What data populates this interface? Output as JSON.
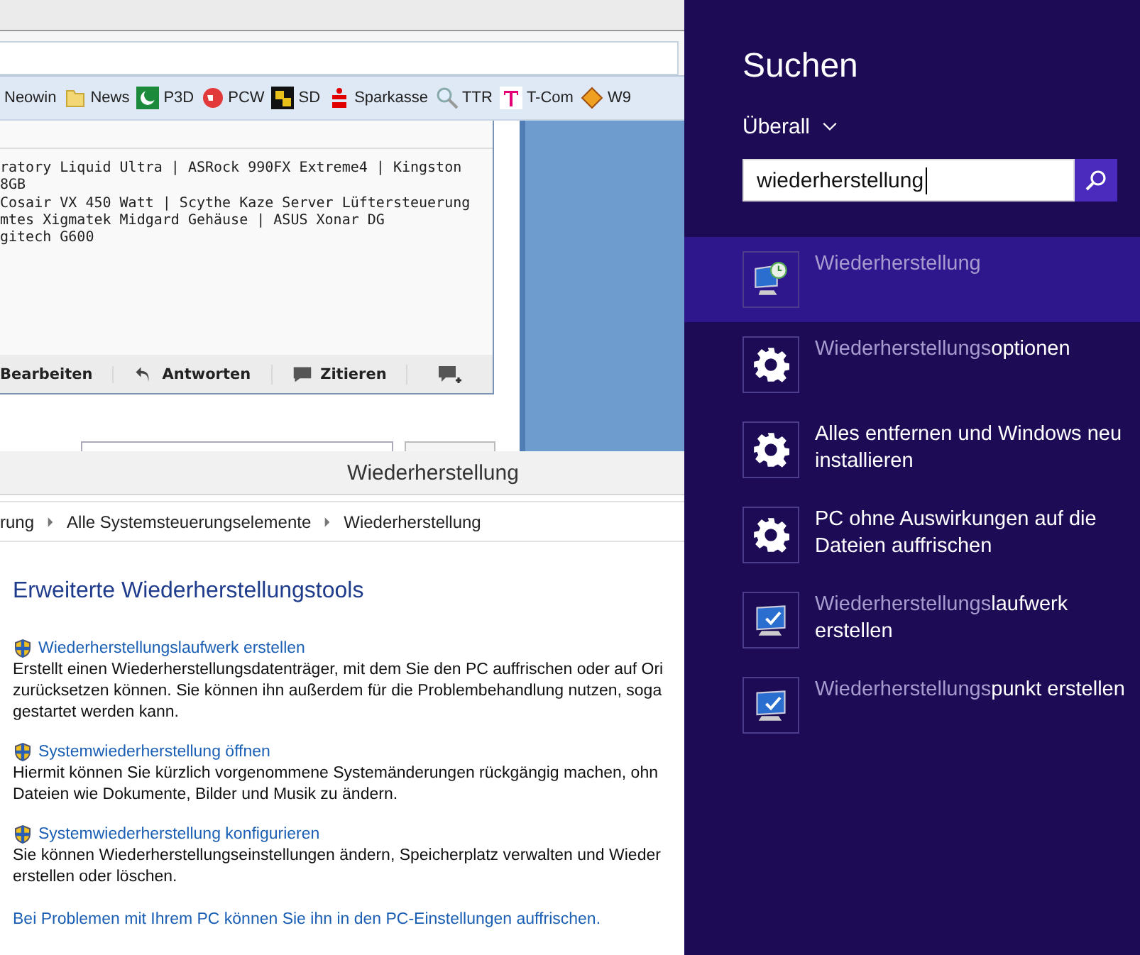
{
  "browser": {
    "bookmarks": [
      {
        "label": "Neowin",
        "kind": "plain"
      },
      {
        "label": "News",
        "kind": "folder"
      },
      {
        "label": "P3D",
        "kind": "crescent"
      },
      {
        "label": "PCW",
        "kind": "globe"
      },
      {
        "label": "SD",
        "kind": "square"
      },
      {
        "label": "Sparkasse",
        "kind": "bank"
      },
      {
        "label": "TTR",
        "kind": "magnifier"
      },
      {
        "label": "T-Com",
        "kind": "tlogo"
      },
      {
        "label": "W9",
        "kind": "diamond"
      }
    ],
    "post": {
      "lines": [
        "ratory Liquid Ultra | ASRock 990FX Extreme4 | Kingston",
        "8GB",
        "Cosair VX 450 Watt | Scythe Kaze Server Lüftersteuerung",
        "mtes Xigmatek Midgard Gehäuse | ASUS Xonar DG",
        "gitech G600"
      ],
      "actions": [
        {
          "label": "Bearbeiten",
          "kind": "plain"
        },
        {
          "label": "Antworten",
          "kind": "reply"
        },
        {
          "label": "Zitieren",
          "kind": "quote"
        }
      ]
    }
  },
  "control_panel": {
    "title": "Wiederherstellung",
    "breadcrumb": [
      "rung",
      "Alle Systemsteuerungselemente",
      "Wiederherstellung"
    ],
    "heading": "Erweiterte Wiederherstellungstools",
    "tools": [
      {
        "link": "Wiederherstellungslaufwerk erstellen",
        "lines": [
          "Erstellt einen Wiederherstellungsdatenträger, mit dem Sie den PC auffrischen oder auf Ori",
          "zurücksetzen können. Sie können ihn außerdem für die Problembehandlung nutzen, soga",
          "gestartet werden kann."
        ]
      },
      {
        "link": "Systemwiederherstellung öffnen",
        "lines": [
          "Hiermit können Sie kürzlich vorgenommene Systemänderungen rückgängig machen, ohn",
          "Dateien wie Dokumente, Bilder und Musik zu ändern."
        ]
      },
      {
        "link": "Systemwiederherstellung konfigurieren",
        "lines": [
          "Sie können Wiederherstellungseinstellungen ändern, Speicherplatz verwalten und Wieder",
          "erstellen oder löschen."
        ]
      }
    ],
    "footer_link": "Bei Problemen mit Ihrem PC können Sie ihn in den PC-Einstellungen auffrischen."
  },
  "search_pane": {
    "title": "Suchen",
    "scope": "Überall",
    "query": "wiederherstellung",
    "results": [
      {
        "kind": "restore",
        "matched": "Wiederherstellung",
        "selected": true
      },
      {
        "kind": "setting",
        "matched": "Wiederherstellungs",
        "text": "optionen",
        "selected": false
      },
      {
        "kind": "setting",
        "text": "Alles entfernen und Windows neu installieren",
        "selected": false
      },
      {
        "kind": "setting",
        "text": "PC ohne Auswirkungen auf die Dateien auffrischen",
        "selected": false
      },
      {
        "kind": "program",
        "matched": "Wiederherstellungs",
        "text": "laufwerk erstellen",
        "selected": false
      },
      {
        "kind": "program",
        "matched": "Wiederherstellungs",
        "text": "punkt erstellen",
        "selected": false
      }
    ]
  }
}
